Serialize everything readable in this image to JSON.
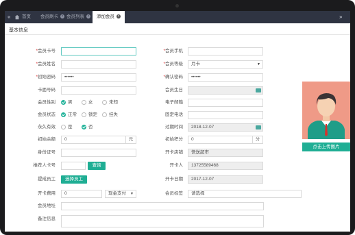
{
  "tabs": [
    {
      "label": "首页"
    },
    {
      "label": "会员刷卡"
    },
    {
      "label": "会员列表"
    },
    {
      "label": "添加会员"
    }
  ],
  "section_title": "基本信息",
  "left_fields": {
    "card_no": {
      "label": "会员卡号",
      "value": ""
    },
    "name": {
      "label": "会员姓名",
      "value": ""
    },
    "initial_password": {
      "label": "初始密码",
      "value": "••••••"
    },
    "card_surface_no": {
      "label": "卡面号码",
      "value": ""
    },
    "gender": {
      "label": "会员性别",
      "options": [
        "男",
        "女",
        "未知"
      ],
      "selected": "男"
    },
    "status": {
      "label": "会员状态",
      "options": [
        "正常",
        "锁定",
        "挂失"
      ],
      "selected": "正常"
    },
    "permanent": {
      "label": "永久有效",
      "options": [
        "是",
        "否"
      ],
      "selected": "否"
    },
    "initial_balance": {
      "label": "初始余额",
      "value": "0",
      "unit": "元"
    },
    "id_number": {
      "label": "身份证号",
      "value": ""
    },
    "referrer": {
      "label": "推荐人卡号",
      "value": "",
      "button": "查询"
    },
    "commission_staff": {
      "label": "提成员工",
      "button": "选择员工"
    },
    "card_fee": {
      "label": "开卡费用",
      "value": "0",
      "payment": "现金支付"
    },
    "address": {
      "label": "会员地址",
      "value": ""
    },
    "remark": {
      "label": "备注信息",
      "value": ""
    }
  },
  "right_fields": {
    "phone": {
      "label": "会员手机",
      "value": ""
    },
    "level": {
      "label": "会员等级",
      "value": "月卡"
    },
    "confirm_password": {
      "label": "确认密码",
      "value": "••••••"
    },
    "birthday": {
      "label": "会员生日",
      "value": ""
    },
    "email": {
      "label": "电子邮箱",
      "value": ""
    },
    "landline": {
      "label": "固定电话",
      "value": ""
    },
    "expire_time": {
      "label": "过期时间",
      "value": "2018-12-07"
    },
    "initial_points": {
      "label": "初始积分",
      "value": "0",
      "unit": "分"
    },
    "store": {
      "label": "开卡店铺",
      "value": "快送超市"
    },
    "opener": {
      "label": "开卡人",
      "value": "13725589468"
    },
    "open_date": {
      "label": "开卡日期",
      "value": "2017-12-07"
    },
    "tags": {
      "label": "会员标签",
      "value": "请选择"
    }
  },
  "upload_button": "点击上传图片",
  "colors": {
    "accent": "#1fae94",
    "tabbar": "#2f3442",
    "avatar_bg": "#ef9a87"
  }
}
